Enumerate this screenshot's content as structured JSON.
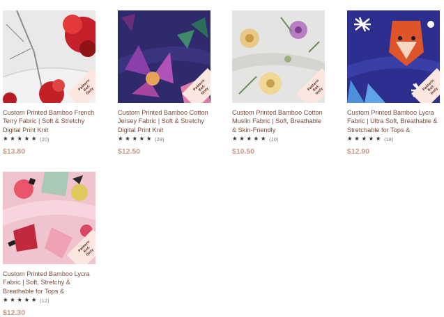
{
  "products": [
    {
      "title": "Custom Printed Bamboo French Terry Fabric | Soft & Stretchy Digital Print Knit",
      "stars": "★★★★★",
      "reviews": "(20)",
      "price": "$13.80",
      "badge": "Pattern Ref. Only"
    },
    {
      "title": "Custom Printed Bamboo Cotton Jersey Fabric | Soft & Stretchy Digital Print Knit",
      "stars": "★★★★★",
      "reviews": "(29)",
      "price": "$12.50",
      "badge": "Pattern Ref. Only"
    },
    {
      "title": "Custom Printed Bamboo Cotton Muslin Fabric | Soft, Breathable & Skin-Friendly",
      "stars": "★★★★★",
      "reviews": "(10)",
      "price": "$10.50",
      "badge": "Pattern Ref. Only"
    },
    {
      "title": "Custom Printed Bamboo Lycra Fabric | Ultra Soft, Breathable & Stretchable for Tops &",
      "stars": "★★★★★",
      "reviews": "(18)",
      "price": "$12.90",
      "badge": "Pattern Ref. Only"
    },
    {
      "title": "Custom Printed Bamboo Lycra Fabric | Soft, Stretchy & Breathable for Tops &",
      "stars": "★★★★★",
      "reviews": "(12)",
      "price": "$12.30",
      "badge": "Pattern Ref. Only"
    }
  ]
}
